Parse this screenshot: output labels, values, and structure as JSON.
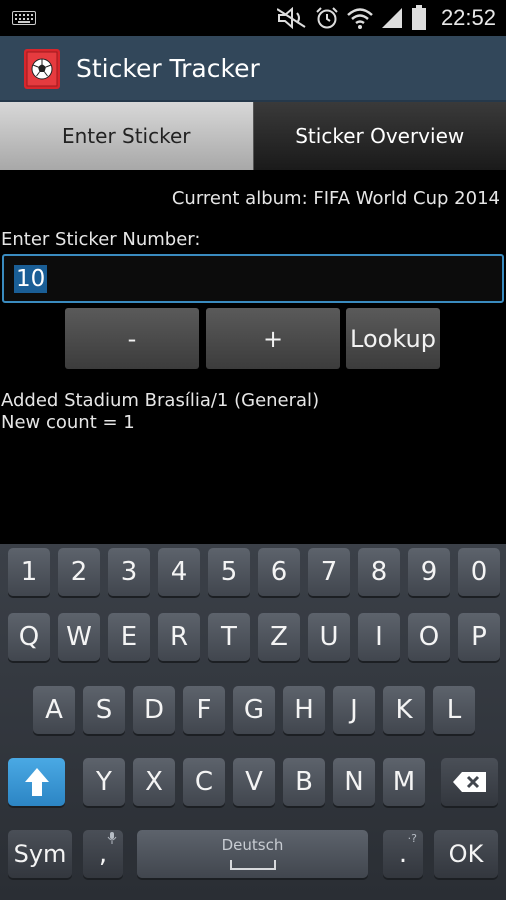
{
  "status_bar": {
    "time": "22:52",
    "icons": [
      "keyboard-icon",
      "mute-icon",
      "alarm-icon",
      "wifi-icon",
      "signal-icon",
      "battery-icon"
    ]
  },
  "app": {
    "title": "Sticker Tracker",
    "icon": "soccer-ball-icon",
    "accent": "#32475a"
  },
  "tabs": [
    {
      "label": "Enter Sticker",
      "active": true
    },
    {
      "label": "Sticker Overview",
      "active": false
    }
  ],
  "main": {
    "current_album": "Current album: FIFA World Cup 2014",
    "enter_label": "Enter Sticker Number:",
    "input_value": "10",
    "buttons": {
      "minus": "-",
      "plus": "+",
      "lookup": "Lookup"
    },
    "result_line1": "Added Stadium Brasília/1 (General)",
    "result_line2": "New count = 1"
  },
  "keyboard": {
    "row1": [
      "1",
      "2",
      "3",
      "4",
      "5",
      "6",
      "7",
      "8",
      "9",
      "0"
    ],
    "row2": [
      "Q",
      "W",
      "E",
      "R",
      "T",
      "Z",
      "U",
      "I",
      "O",
      "P"
    ],
    "row3": [
      "A",
      "S",
      "D",
      "F",
      "G",
      "H",
      "J",
      "K",
      "L"
    ],
    "row4": [
      "Y",
      "X",
      "C",
      "V",
      "B",
      "N",
      "M"
    ],
    "sym": "Sym",
    "comma": ",",
    "comma_sup": "🎤",
    "space_label": "Deutsch",
    "period": ".",
    "period_sup": "·?",
    "ok": "OK",
    "shift_icon": "shift-arrow-icon",
    "backspace_icon": "backspace-icon",
    "shift_color": "#2c85c4"
  }
}
